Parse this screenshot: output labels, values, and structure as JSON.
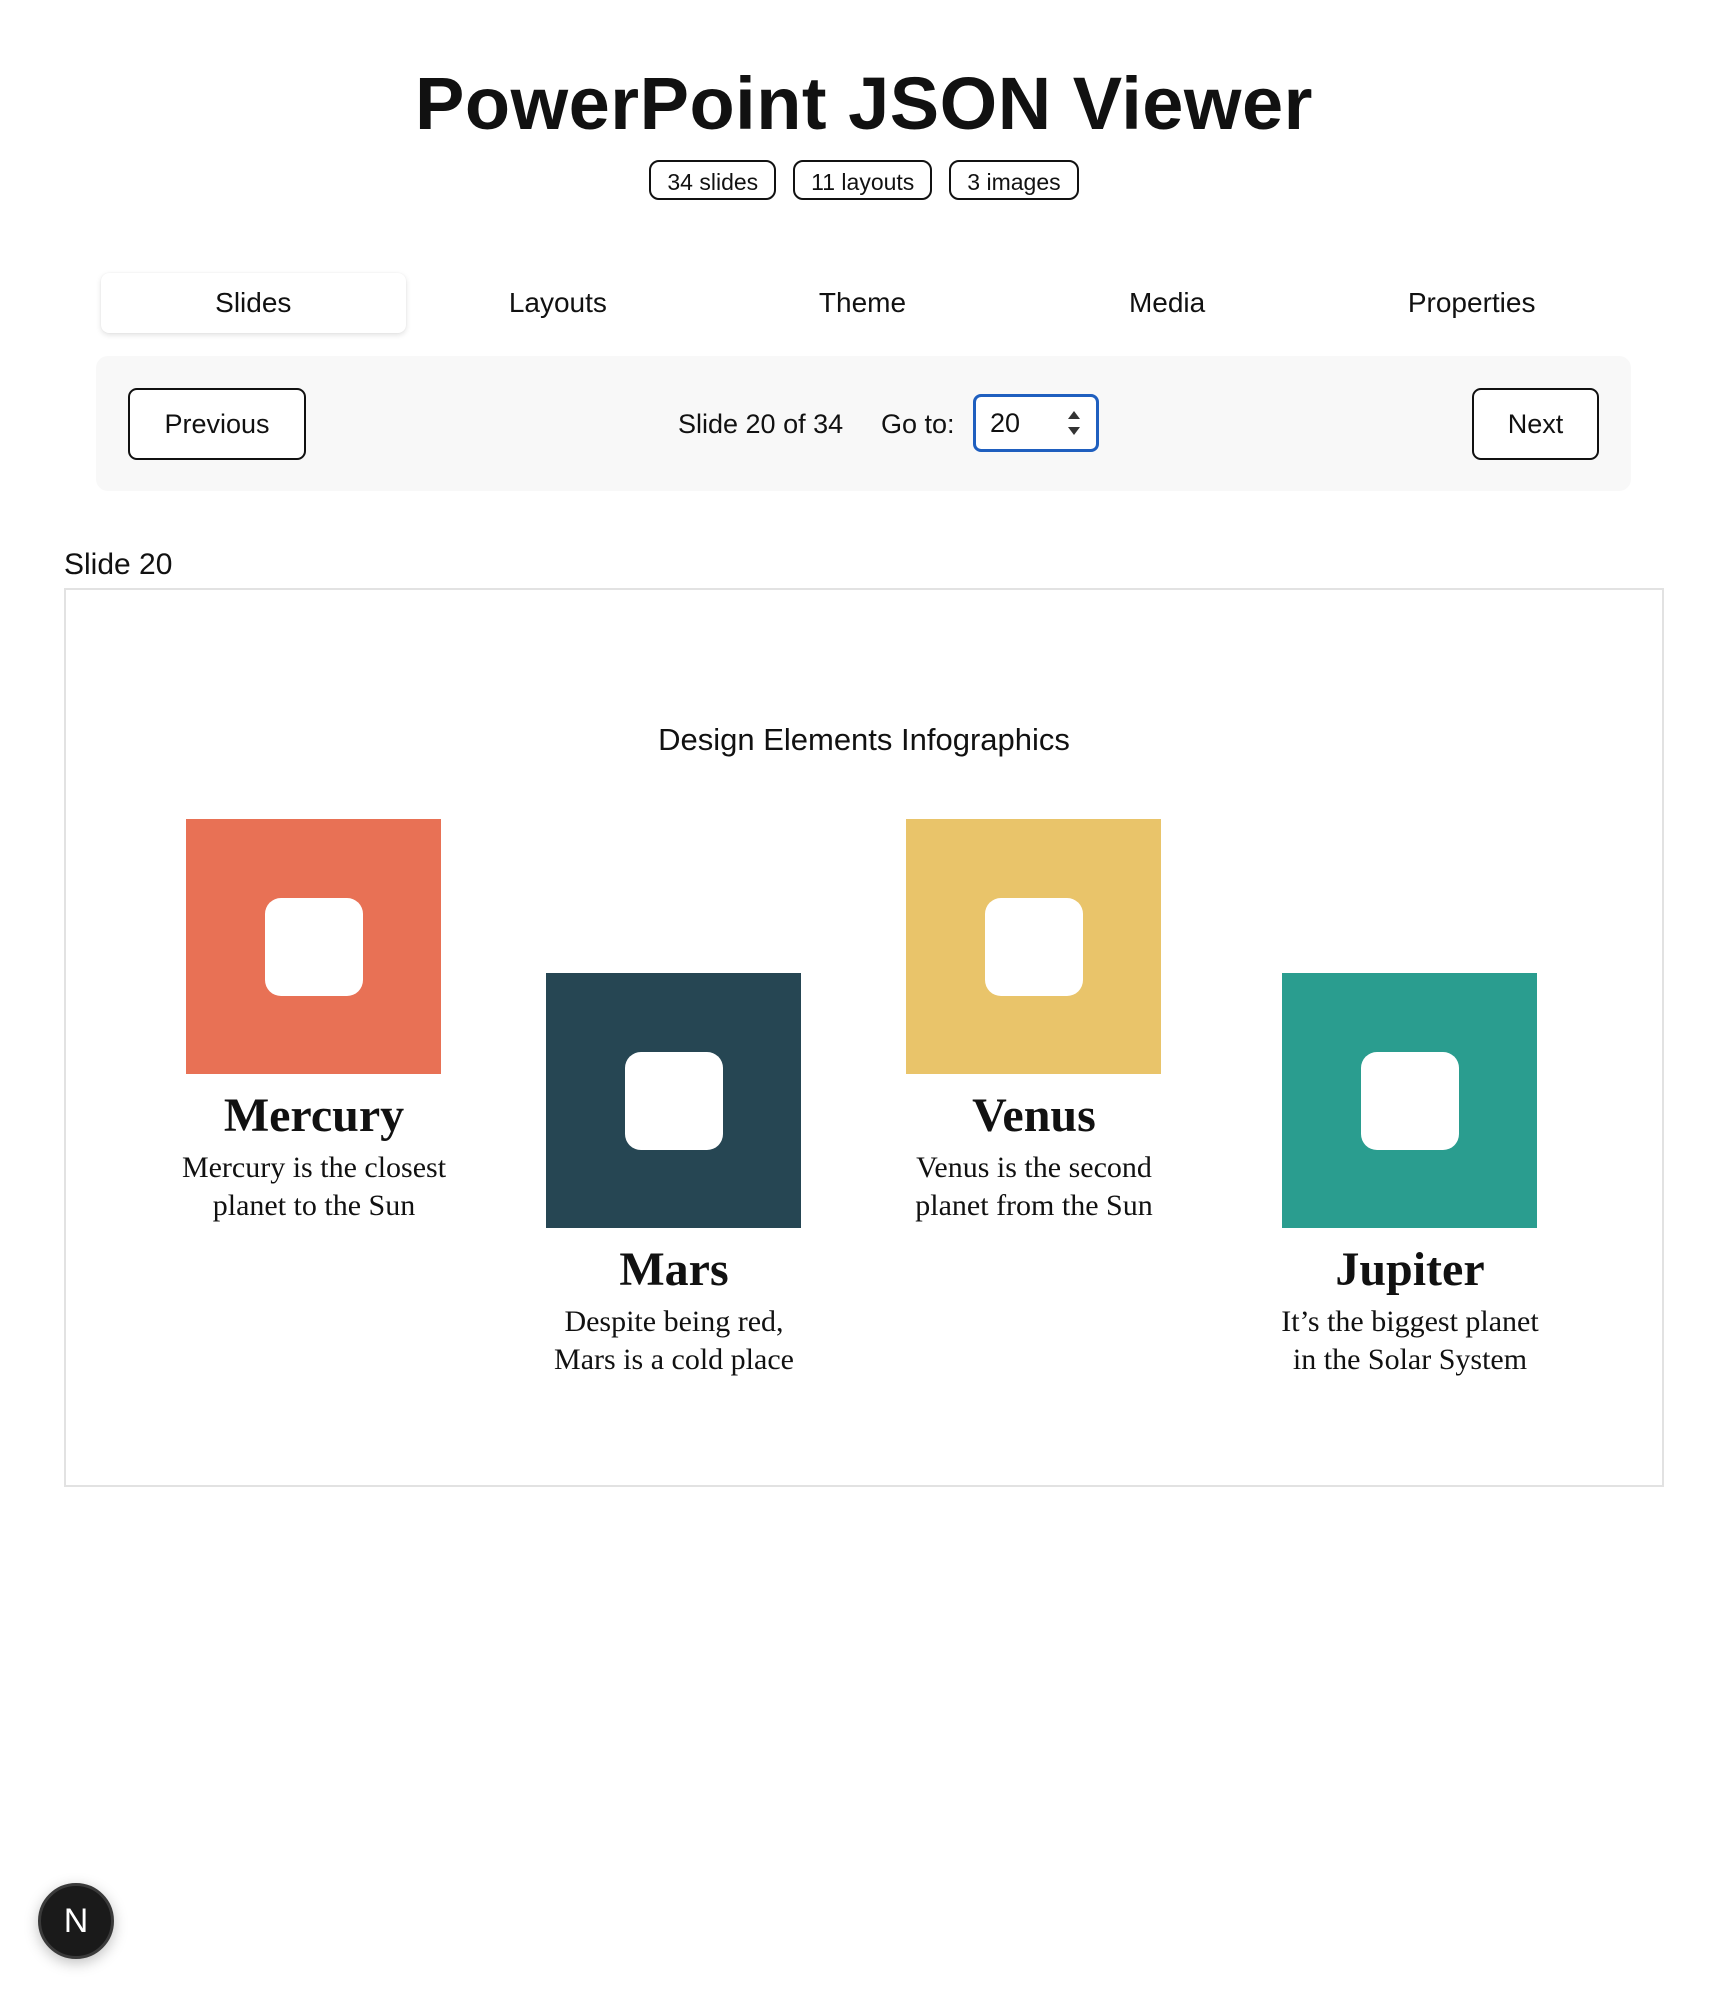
{
  "header": {
    "title": "PowerPoint JSON Viewer",
    "badges": [
      "34 slides",
      "11 layouts",
      "3 images"
    ]
  },
  "tabs": [
    {
      "label": "Slides",
      "active": true
    },
    {
      "label": "Layouts",
      "active": false
    },
    {
      "label": "Theme",
      "active": false
    },
    {
      "label": "Media",
      "active": false
    },
    {
      "label": "Properties",
      "active": false
    }
  ],
  "navigation": {
    "previous_label": "Previous",
    "next_label": "Next",
    "slide_status": "Slide 20 of 34",
    "goto_label": "Go to:",
    "goto_value": "20"
  },
  "slide": {
    "label": "Slide 20",
    "title": "Design Elements Infographics",
    "planets": [
      {
        "name": "Mercury",
        "desc_line1": "Mercury is the closest",
        "desc_line2": "planet to the Sun",
        "color": "#e87155"
      },
      {
        "name": "Mars",
        "desc_line1": "Despite being red,",
        "desc_line2": "Mars is a cold place",
        "color": "#264653"
      },
      {
        "name": "Venus",
        "desc_line1": "Venus is the second",
        "desc_line2": "planet from the Sun",
        "color": "#e9c46a"
      },
      {
        "name": "Jupiter",
        "desc_line1": "It’s the biggest planet",
        "desc_line2": "in the Solar System",
        "color": "#2a9d8f"
      }
    ]
  },
  "dev_badge": {
    "letter": "N"
  },
  "colors": {
    "focus_ring": "#1f5fbf",
    "navbar_bg": "#f8f8f8",
    "frame_border": "#e2e2e2"
  }
}
